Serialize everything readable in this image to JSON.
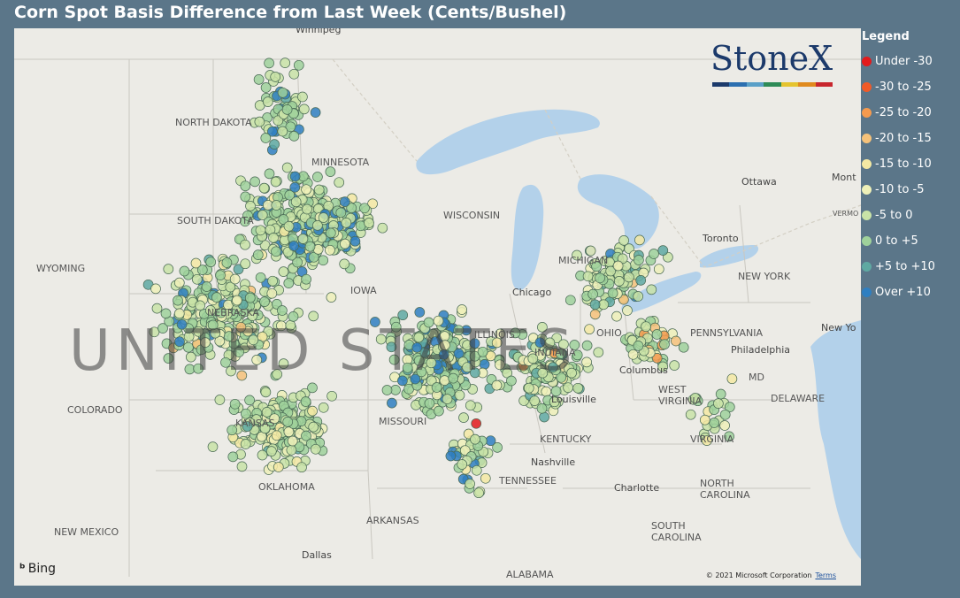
{
  "title": "Corn Spot Basis Difference from Last Week (Cents/Bushel)",
  "legend": {
    "title": "Legend",
    "items": [
      {
        "label": "Under -30",
        "color": "#e31a1c"
      },
      {
        "label": "-30 to -25",
        "color": "#f05a28"
      },
      {
        "label": "-25 to -20",
        "color": "#f59a4e"
      },
      {
        "label": "-20 to -15",
        "color": "#f6c27a"
      },
      {
        "label": "-15 to -10",
        "color": "#f4e9a3"
      },
      {
        "label": "-10 to -5",
        "color": "#eef0b8"
      },
      {
        "label": "-5 to 0",
        "color": "#c9e3a7"
      },
      {
        "label": "0 to +5",
        "color": "#9fd19b"
      },
      {
        "label": "+5 to +10",
        "color": "#5fa9a2"
      },
      {
        "label": "Over +10",
        "color": "#2f7fc1"
      }
    ]
  },
  "logo": {
    "text": "StoneX",
    "tm": "™",
    "stripe_colors": [
      "#1c3a6b",
      "#2c6fb0",
      "#5aa0c8",
      "#2e8b57",
      "#e5c42f",
      "#e08a1e",
      "#c8262d"
    ]
  },
  "map": {
    "regions": [
      "NORTH DAKOTA",
      "MINNESOTA",
      "SOUTH DAKOTA",
      "WYOMING",
      "NEBRASKA",
      "IOWA",
      "COLORADO",
      "KANSAS",
      "MISSOURI",
      "OKLAHOMA",
      "ARKANSAS",
      "NEW MEXICO",
      "TENNESSEE",
      "KENTUCKY",
      "WEST VIRGINIA",
      "VIRGINIA",
      "NORTH CAROLINA",
      "SOUTH CAROLINA",
      "ALABAMA",
      "PENNSYLVANIA",
      "NEW YORK",
      "MICHIGAN",
      "WISCONSIN",
      "INDIANA",
      "ILLINOIS",
      "OHIO",
      "DELAWARE",
      "MD",
      "VERMONT"
    ],
    "cities": [
      "Winnipeg",
      "Ottawa",
      "Montreal",
      "Toronto",
      "Chicago",
      "Columbus",
      "Louisville",
      "Nashville",
      "Philadelphia",
      "Dallas",
      "Charlotte",
      "New York"
    ],
    "country_label": "UNITED STATES",
    "bing": "Bing",
    "copyright": "© 2021 Microsoft Corporation",
    "terms": "Terms"
  }
}
